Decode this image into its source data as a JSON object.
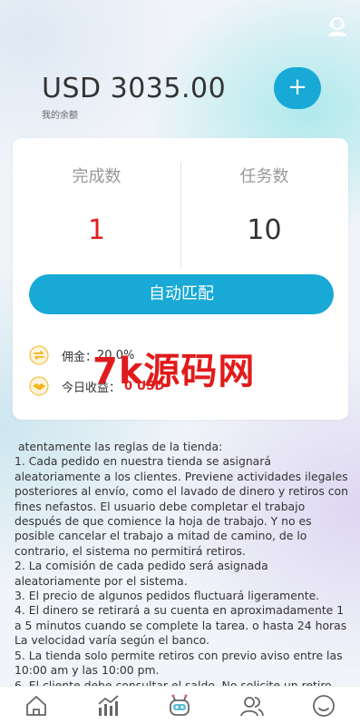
{
  "header": {
    "balance": "USD 3035.00",
    "balance_label": "我的余额",
    "add_button": "+"
  },
  "stats": {
    "completed_label": "完成数",
    "completed_value": "1",
    "tasks_label": "任务数",
    "tasks_value": "10"
  },
  "match_button": "自动匹配",
  "commission": {
    "label": "佣金：",
    "value": "20.0%"
  },
  "today_income": {
    "label": "今日收益：",
    "value": "0 USD"
  },
  "watermark": "7k源码网",
  "rules": [
    " atentamente las reglas de la tienda:",
    "1. Cada pedido en nuestra tienda se asignará aleatoriamente a los clientes. Previene actividades ilegales posteriores al envío, como el lavado de dinero y retiros con fines nefastos. El usuario debe completar el trabajo después de que comience la hoja de trabajo. Y no es posible cancelar el trabajo a mitad de camino, de lo contrario, el sistema no permitirá retiros.",
    "2. La comisión de cada pedido será asignada aleatoriamente por el sistema.",
    "3. El precio de algunos pedidos fluctuará ligeramente.",
    "4. El dinero se retirará a su cuenta en aproximadamente 1 a 5 minutos cuando se complete la tarea. o hasta 24 horas La velocidad varía según el banco.",
    "5. La tienda solo permite retiros con previo aviso entre las 10:00 am y las 10:00 pm.",
    "6. El cliente debe consultar el saldo. No solicite un retiro"
  ],
  "tabs": [
    "home-icon",
    "chart-icon",
    "robot-icon",
    "team-icon",
    "profile-icon"
  ],
  "colors": {
    "accent": "#18a9d6",
    "red": "#e02020",
    "gold": "#f3b51c"
  }
}
